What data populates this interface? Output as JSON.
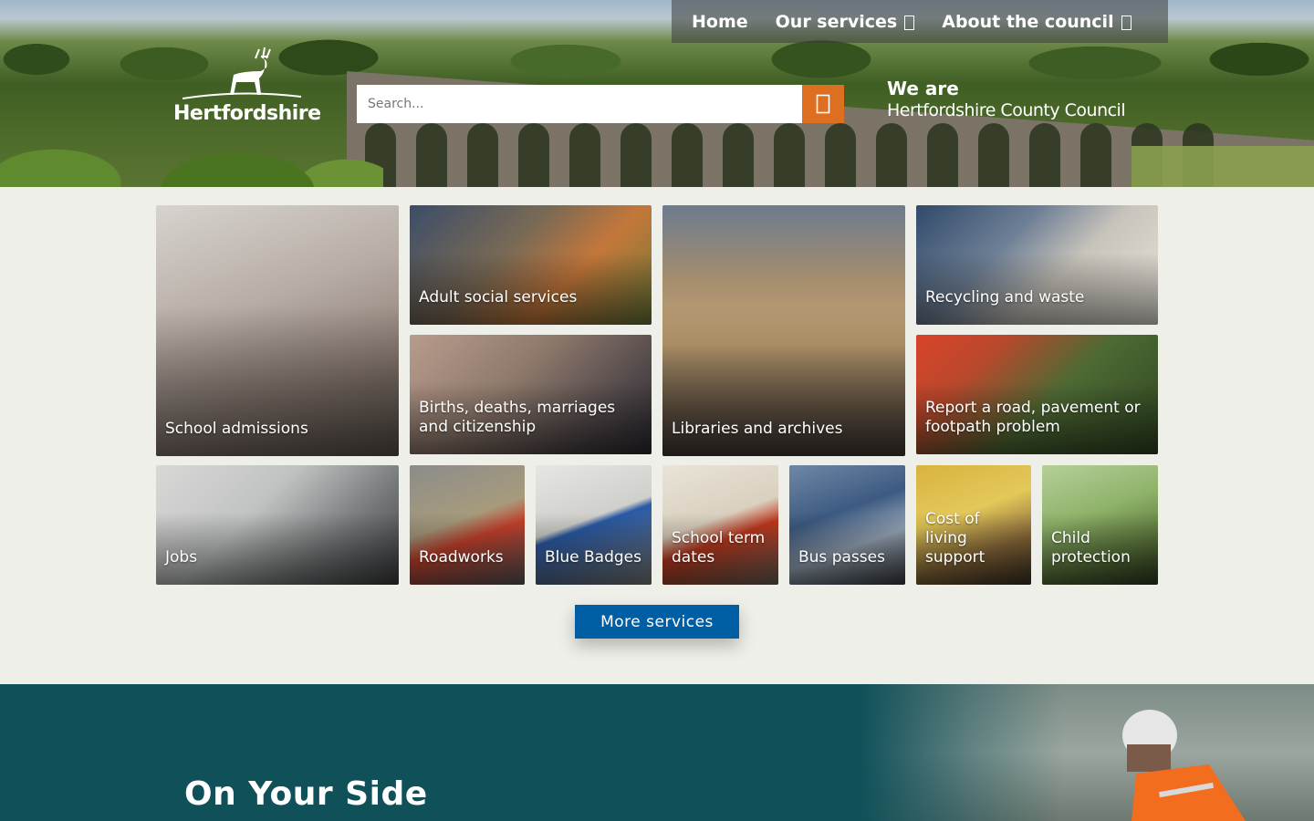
{
  "nav": {
    "home": "Home",
    "our_services": "Our services",
    "about": "About the council"
  },
  "logo": {
    "text": "Hertfordshire"
  },
  "search": {
    "placeholder": "Search..."
  },
  "tagline": {
    "we_are": "We are",
    "name": "Hertfordshire County Council"
  },
  "tiles": [
    {
      "label": "School admissions"
    },
    {
      "label": "Adult social services"
    },
    {
      "label": "Libraries and archives"
    },
    {
      "label": "Recycling and waste"
    },
    {
      "label": "Births, deaths, marriages and citizenship"
    },
    {
      "label": "Report a road, pavement or footpath problem"
    },
    {
      "label": "Jobs"
    },
    {
      "label": "Roadworks"
    },
    {
      "label": "Blue Badges"
    },
    {
      "label": "School term dates"
    },
    {
      "label": "Bus passes"
    },
    {
      "label": "Cost of living support"
    },
    {
      "label": "Child protection"
    }
  ],
  "more_services": "More services",
  "band": {
    "heading": "On Your Side"
  },
  "colors": {
    "search_button": "#de6f21",
    "more_button": "#005ea5",
    "band": "#0f5059"
  },
  "icons": {
    "search": "search-icon",
    "dropdown": "chevron-down-icon",
    "logo": "stag-logo-icon"
  }
}
